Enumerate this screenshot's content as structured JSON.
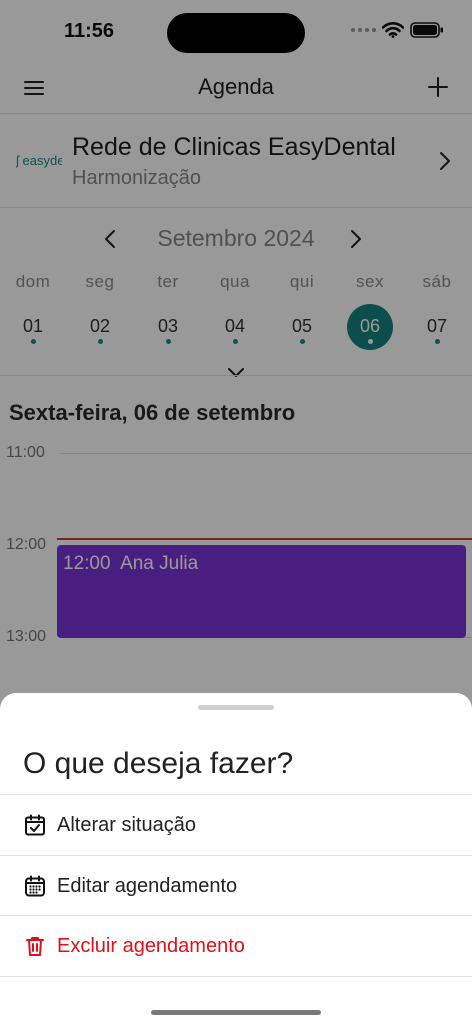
{
  "status_bar": {
    "time": "11:56"
  },
  "header": {
    "title": "Agenda"
  },
  "clinic": {
    "logo_text": "easydental",
    "name": "Rede de Clinicas EasyDental",
    "specialty": "Harmonização"
  },
  "calendar": {
    "month_label": "Setembro 2024",
    "days": [
      {
        "dow": "dom",
        "num": "01",
        "selected": false
      },
      {
        "dow": "seg",
        "num": "02",
        "selected": false
      },
      {
        "dow": "ter",
        "num": "03",
        "selected": false
      },
      {
        "dow": "qua",
        "num": "04",
        "selected": false
      },
      {
        "dow": "qui",
        "num": "05",
        "selected": false
      },
      {
        "dow": "sex",
        "num": "06",
        "selected": true
      },
      {
        "dow": "sáb",
        "num": "07",
        "selected": false
      }
    ]
  },
  "schedule": {
    "day_title": "Sexta-feira, 06 de setembro",
    "hours": [
      "11:00",
      "12:00",
      "13:00"
    ],
    "event": {
      "time": "12:00",
      "patient": "Ana Julia",
      "color": "#7b33d8"
    }
  },
  "action_sheet": {
    "title": "O que deseja fazer?",
    "items": [
      {
        "label": "Alterar situação",
        "icon": "calendar-check-icon",
        "danger": false
      },
      {
        "label": "Editar agendamento",
        "icon": "calendar-grid-icon",
        "danger": false
      },
      {
        "label": "Excluir agendamento",
        "icon": "trash-icon",
        "danger": true
      }
    ]
  },
  "colors": {
    "accent": "#13837d",
    "danger": "#e0101a",
    "event": "#7b33d8",
    "now_line": "#e03535"
  }
}
